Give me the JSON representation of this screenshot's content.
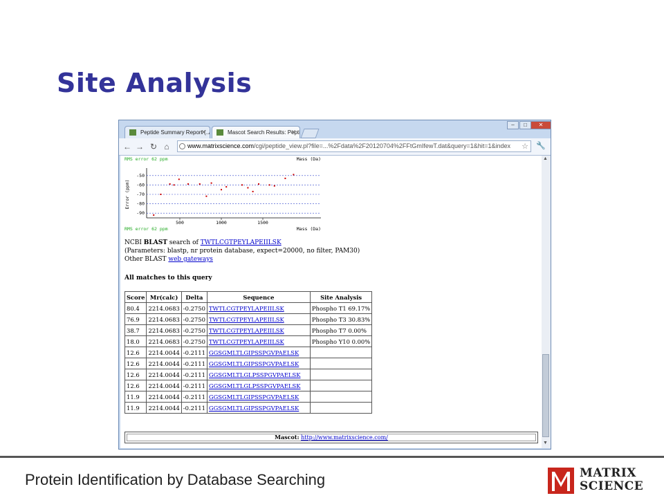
{
  "slide": {
    "title": "Site Analysis",
    "footer": "Protein Identification by Database Searching",
    "logo_line1": "MATRIX",
    "logo_line2": "SCIENCE",
    "title_color": "#333399"
  },
  "browser": {
    "tabs": [
      {
        "label": "Peptide Summary Report (../c",
        "active": false
      },
      {
        "label": "Mascot Search Results: Pepti",
        "active": true
      }
    ],
    "window_controls": [
      "minimize",
      "maximize",
      "close"
    ],
    "url_host": "www.matrixscience.com",
    "url_path": "/cgi/peptide_view.pl?file=...%2Fdata%2F20120704%2FFtGmIfewT.dat&query=1&hit=1&index"
  },
  "page": {
    "plot": {
      "rms_label": "RMS error 62 ppm",
      "mass_label": "Mass (Da)",
      "y_axis_label": "Error (ppm)",
      "y_ticks": [
        "-50",
        "-60",
        "-70",
        "-80",
        "-90"
      ],
      "x_ticks": [
        "500",
        "1000",
        "1500"
      ],
      "rms_color": "#22aa22",
      "point_color": "#cc0000"
    },
    "blast_prefix": "NCBI ",
    "blast_bold": "BLAST",
    "blast_mid": " search of ",
    "blast_link": "TWTLCGTPEYLAPEIILSK",
    "blast_params": "(Parameters: blastp, nr protein database, expect=20000, no filter, PAM30)",
    "other_blast": "Other BLAST ",
    "other_blast_link": "web gateways",
    "matches_heading": "All matches to this query",
    "table_headers": [
      "Score",
      "Mr(calc)",
      "Delta",
      "Sequence",
      "Site Analysis"
    ],
    "rows": [
      {
        "score": "80.4",
        "mr": "2214.0683",
        "delta": "-0.2750",
        "seq": "TWTLCGTPEYLAPEIILSK",
        "site": "Phospho T1 69.17%"
      },
      {
        "score": "76.9",
        "mr": "2214.0683",
        "delta": "-0.2750",
        "seq": "TWTLCGTPEYLAPEIILSK",
        "site": "Phospho T3 30.83%"
      },
      {
        "score": "38.7",
        "mr": "2214.0683",
        "delta": "-0.2750",
        "seq": "TWTLCGTPEYLAPEIILSK",
        "site": "Phospho T7 0.00%"
      },
      {
        "score": "18.0",
        "mr": "2214.0683",
        "delta": "-0.2750",
        "seq": "TWTLCGTPEYLAPEIILSK",
        "site": "Phospho Y10 0.00%"
      },
      {
        "score": "12.6",
        "mr": "2214.0044",
        "delta": "-0.2111",
        "seq": "GGSGMLTLGIPSSPGVPAELSK",
        "site": ""
      },
      {
        "score": "12.6",
        "mr": "2214.0044",
        "delta": "-0.2111",
        "seq": "GGSGMLTLGIPSSPGVPAELSK",
        "site": ""
      },
      {
        "score": "12.6",
        "mr": "2214.0044",
        "delta": "-0.2111",
        "seq": "GGSGMLTLGLPSSPGVPAELSK",
        "site": ""
      },
      {
        "score": "12.6",
        "mr": "2214.0044",
        "delta": "-0.2111",
        "seq": "GGSGMLTLGLPSSPGVPAELSK",
        "site": ""
      },
      {
        "score": "11.9",
        "mr": "2214.0044",
        "delta": "-0.2111",
        "seq": "GGSGMLTLGIPSSPGVPAELSK",
        "site": ""
      },
      {
        "score": "11.9",
        "mr": "2214.0044",
        "delta": "-0.2111",
        "seq": "GGSGMLTLGIPSSPGVPAELSK",
        "site": ""
      }
    ],
    "mascot_label": "Mascot:",
    "mascot_link": "http://www.matrixscience.com/"
  },
  "chart_data": {
    "type": "scatter",
    "title": "",
    "xlabel": "Mass (Da)",
    "ylabel": "Error (ppm)",
    "xlim": [
      100,
      2200
    ],
    "ylim": [
      -95,
      -45
    ],
    "x_ticks": [
      500,
      1000,
      1500
    ],
    "y_ticks": [
      -50,
      -60,
      -70,
      -80,
      -90
    ],
    "annotation": "RMS error 62 ppm",
    "points": [
      {
        "x": 185,
        "y": -92
      },
      {
        "x": 270,
        "y": -70
      },
      {
        "x": 380,
        "y": -59
      },
      {
        "x": 430,
        "y": -60
      },
      {
        "x": 490,
        "y": -54
      },
      {
        "x": 600,
        "y": -59
      },
      {
        "x": 740,
        "y": -59
      },
      {
        "x": 820,
        "y": -72
      },
      {
        "x": 880,
        "y": -58
      },
      {
        "x": 1000,
        "y": -65
      },
      {
        "x": 1060,
        "y": -62
      },
      {
        "x": 1250,
        "y": -60
      },
      {
        "x": 1320,
        "y": -63
      },
      {
        "x": 1380,
        "y": -67
      },
      {
        "x": 1450,
        "y": -59
      },
      {
        "x": 1580,
        "y": -60
      },
      {
        "x": 1640,
        "y": -61
      },
      {
        "x": 1770,
        "y": -53
      },
      {
        "x": 1870,
        "y": -49
      }
    ]
  }
}
